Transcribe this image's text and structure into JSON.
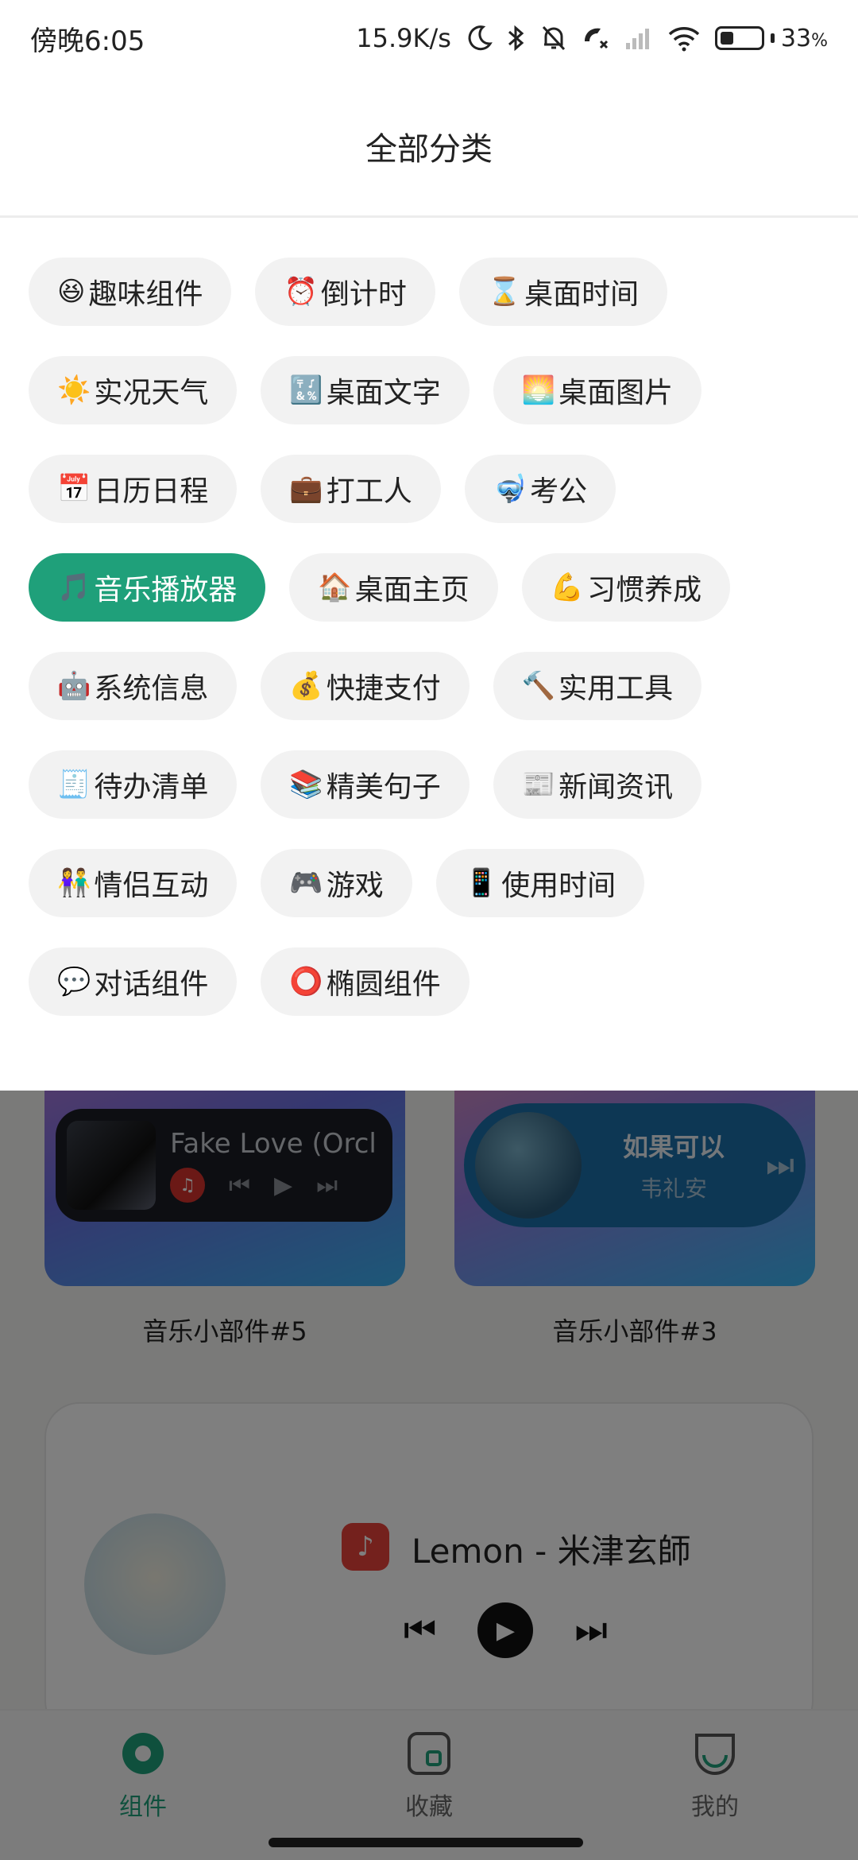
{
  "status_bar": {
    "time": "傍晚6:05",
    "net_speed": "15.9K/s",
    "battery": "33",
    "battery_unit": "%"
  },
  "sheet": {
    "title": "全部分类",
    "categories": [
      {
        "emoji": "😆",
        "label": "趣味组件",
        "selected": false
      },
      {
        "emoji": "⏰",
        "label": "倒计时",
        "selected": false
      },
      {
        "emoji": "⌛",
        "label": "桌面时间",
        "selected": false
      },
      {
        "emoji": "☀️",
        "label": "实况天气",
        "selected": false
      },
      {
        "emoji": "🔣",
        "label": "桌面文字",
        "selected": false
      },
      {
        "emoji": "🌅",
        "label": "桌面图片",
        "selected": false
      },
      {
        "emoji": "📅",
        "label": "日历日程",
        "selected": false
      },
      {
        "emoji": "💼",
        "label": "打工人",
        "selected": false
      },
      {
        "emoji": "🤿",
        "label": "考公",
        "selected": false
      },
      {
        "emoji": "🎵",
        "label": "音乐播放器",
        "selected": true
      },
      {
        "emoji": "🏠",
        "label": "桌面主页",
        "selected": false
      },
      {
        "emoji": "💪",
        "label": "习惯养成",
        "selected": false
      },
      {
        "emoji": "🤖",
        "label": "系统信息",
        "selected": false
      },
      {
        "emoji": "💰",
        "label": "快捷支付",
        "selected": false
      },
      {
        "emoji": "🔨",
        "label": "实用工具",
        "selected": false
      },
      {
        "emoji": "🧾",
        "label": "待办清单",
        "selected": false
      },
      {
        "emoji": "📚",
        "label": "精美句子",
        "selected": false
      },
      {
        "emoji": "📰",
        "label": "新闻资讯",
        "selected": false
      },
      {
        "emoji": "👫",
        "label": "情侣互动",
        "selected": false
      },
      {
        "emoji": "🎮",
        "label": "游戏",
        "selected": false
      },
      {
        "emoji": "📱",
        "label": "使用时间",
        "selected": false
      },
      {
        "emoji": "💬",
        "label": "对话组件",
        "selected": false
      },
      {
        "emoji": "⭕",
        "label": "椭圆组件",
        "selected": false
      }
    ]
  },
  "widgets": {
    "card_a": {
      "song": "Fake Love (Orcl",
      "label": "音乐小部件#5"
    },
    "card_b": {
      "song": "如果可以",
      "artist": "韦礼安",
      "label": "音乐小部件#3"
    },
    "card_lemon": {
      "song": "Lemon - 米津玄師"
    }
  },
  "bottom_nav": {
    "items": [
      {
        "label": "组件",
        "active": true
      },
      {
        "label": "收藏",
        "active": false
      },
      {
        "label": "我的",
        "active": false
      }
    ]
  },
  "colors": {
    "accent": "#1fa07a",
    "chip_bg": "#f2f2f2"
  }
}
